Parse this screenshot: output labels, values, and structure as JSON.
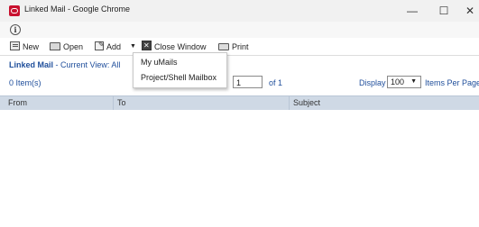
{
  "window": {
    "title": "Linked Mail - Google Chrome",
    "controls": {
      "minimize": "—",
      "maximize": "☐",
      "close": "✕"
    }
  },
  "infobar": {
    "icon": "info-icon"
  },
  "toolbar": {
    "new_label": "New",
    "open_label": "Open",
    "add_label": "Add",
    "close_window_label": "Close Window",
    "print_label": "Print"
  },
  "add_menu": {
    "items": [
      "My uMails",
      "Project/Shell Mailbox"
    ]
  },
  "header": {
    "title": "Linked Mail",
    "view": " - Current View: All"
  },
  "list": {
    "count": "0 Item(s)",
    "page": "1",
    "of_pages": "of 1",
    "display_label": "Display",
    "display_value": "100",
    "per_page_label": "Items Per Page"
  },
  "grid": {
    "columns": [
      "From",
      "To",
      "Subject"
    ]
  },
  "colors": {
    "link_blue": "#1f4e9b",
    "header_bg": "#cfd9e5",
    "brand_red": "#c8102e"
  }
}
